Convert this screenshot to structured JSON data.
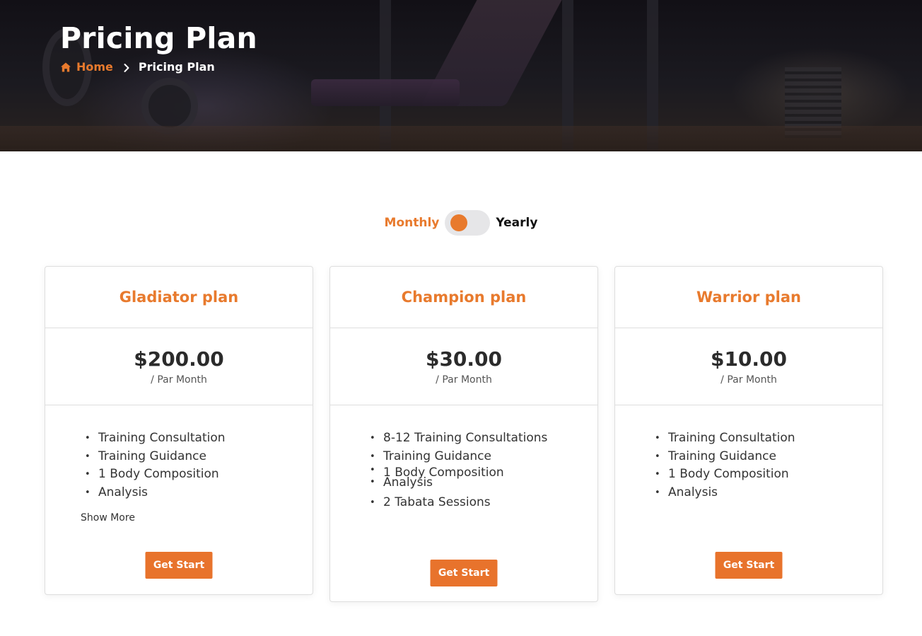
{
  "hero": {
    "title": "Pricing Plan",
    "breadcrumb": {
      "home": "Home",
      "current": "Pricing Plan"
    }
  },
  "billing_toggle": {
    "monthly": "Monthly",
    "yearly": "Yearly",
    "selected": "Monthly"
  },
  "colors": {
    "accent": "#e87a2d",
    "button": "#e8732c",
    "text": "#2b2b2b"
  },
  "icons": {
    "home": "home-icon",
    "separator": "chevron-right-icon"
  },
  "plans": [
    {
      "name": "Gladiator plan",
      "price": "$200.00",
      "period": "/ Par Month",
      "features": [
        "Training Consultation",
        "Training Guidance",
        "1 Body Composition",
        "Analysis"
      ],
      "show_more": "Show More",
      "cta": "Get Start"
    },
    {
      "name": "Champion plan",
      "price": "$30.00",
      "period": "/ Par Month",
      "features": [
        "8-12 Training Consultations",
        "Training Guidance",
        "1 Body Composition",
        "Analysis",
        "2 Tabata Sessions"
      ],
      "cta": "Get Start"
    },
    {
      "name": "Warrior plan",
      "price": "$10.00",
      "period": "/ Par Month",
      "features": [
        "Training Consultation",
        "Training Guidance",
        "1 Body Composition",
        "Analysis"
      ],
      "cta": "Get Start"
    }
  ]
}
